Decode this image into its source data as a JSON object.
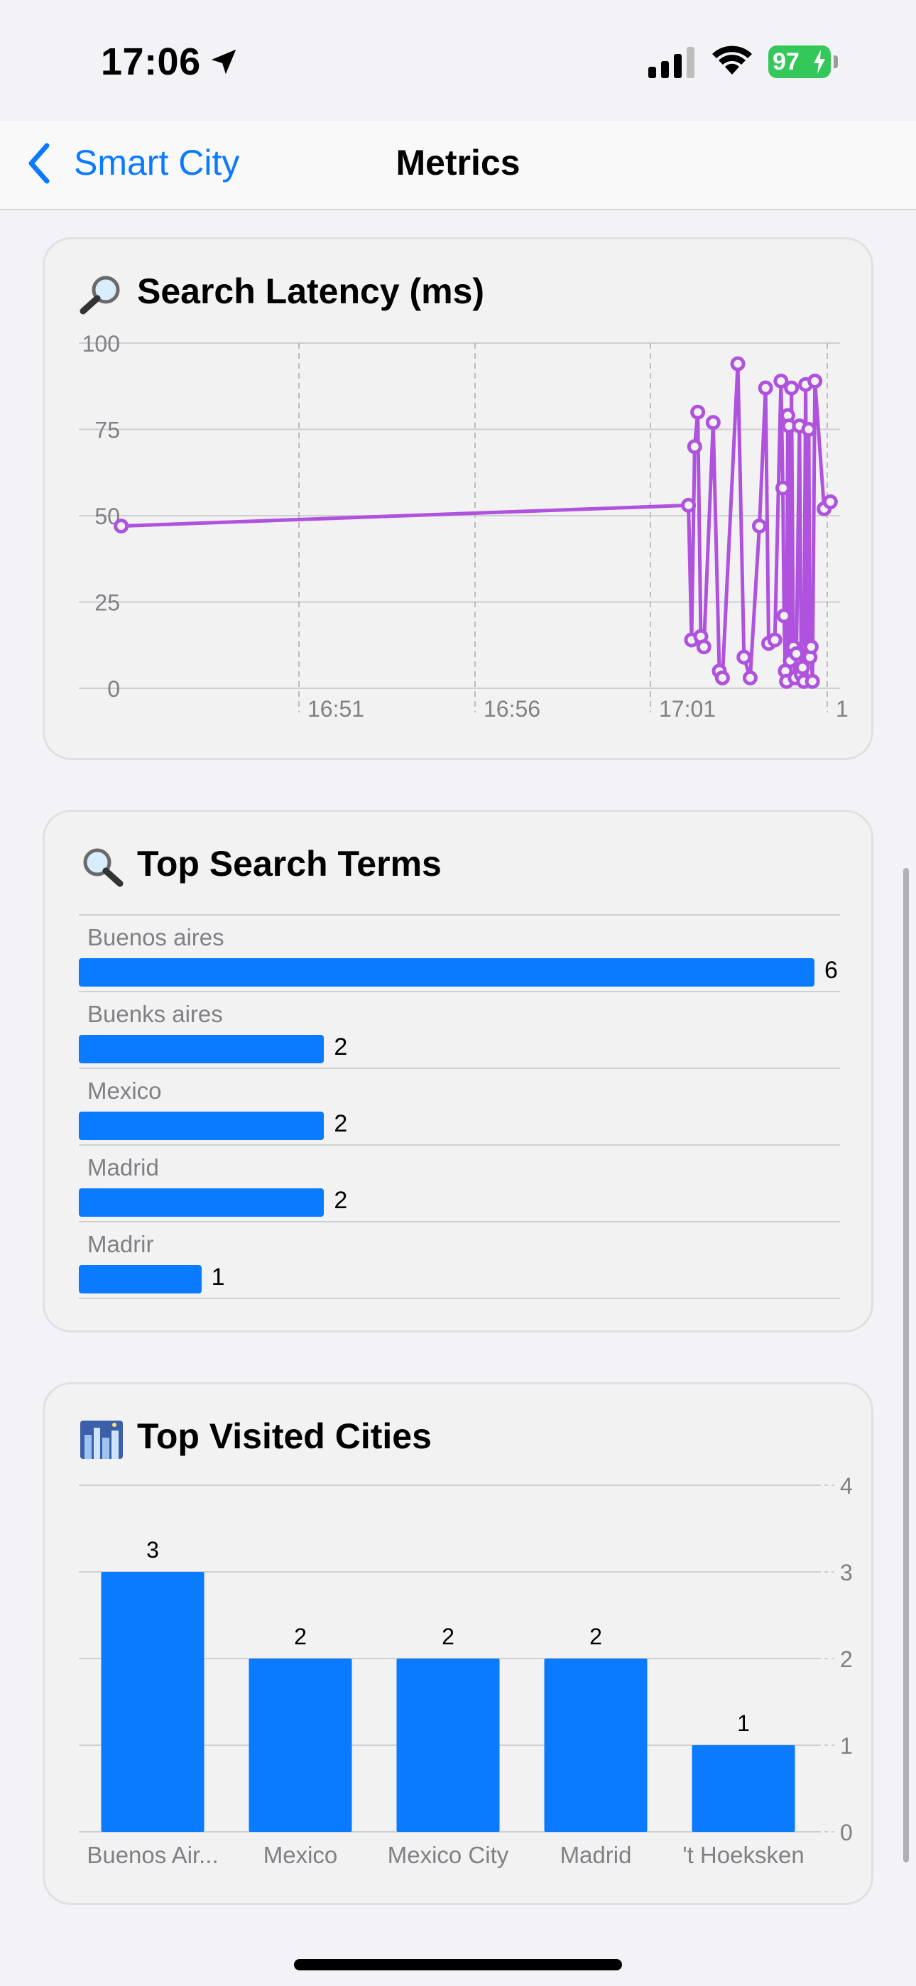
{
  "status": {
    "time": "17:06",
    "battery": "97"
  },
  "nav": {
    "back_label": "Smart City",
    "title": "Metrics"
  },
  "latency": {
    "title": "Search Latency (ms)",
    "icon": "magnifier-left-icon",
    "chart_data": {
      "type": "line",
      "ylim": [
        0,
        100
      ],
      "yticks": [
        0,
        25,
        50,
        75,
        100
      ],
      "xticks": [
        "16:51",
        "16:56",
        "17:01",
        "1"
      ],
      "color": "#af52de",
      "points": [
        {
          "t": "16:45:55",
          "y": 47
        },
        {
          "t": "17:01:15",
          "y": 53
        },
        {
          "t": "17:01:20",
          "y": 14
        },
        {
          "t": "17:01:25",
          "y": 70
        },
        {
          "t": "17:01:30",
          "y": 80
        },
        {
          "t": "17:01:35",
          "y": 15
        },
        {
          "t": "17:01:40",
          "y": 12
        },
        {
          "t": "17:01:55",
          "y": 77
        },
        {
          "t": "17:02:05",
          "y": 5
        },
        {
          "t": "17:02:10",
          "y": 3
        },
        {
          "t": "17:02:35",
          "y": 94
        },
        {
          "t": "17:02:45",
          "y": 9
        },
        {
          "t": "17:02:55",
          "y": 3
        },
        {
          "t": "17:03:10",
          "y": 47
        },
        {
          "t": "17:03:20",
          "y": 87
        },
        {
          "t": "17:03:25",
          "y": 13
        },
        {
          "t": "17:03:35",
          "y": 14
        },
        {
          "t": "17:03:45",
          "y": 89
        },
        {
          "t": "17:03:48",
          "y": 58
        },
        {
          "t": "17:03:50",
          "y": 21
        },
        {
          "t": "17:03:52",
          "y": 5
        },
        {
          "t": "17:03:54",
          "y": 2
        },
        {
          "t": "17:03:56",
          "y": 79
        },
        {
          "t": "17:03:58",
          "y": 76
        },
        {
          "t": "17:04:00",
          "y": 8
        },
        {
          "t": "17:04:02",
          "y": 87
        },
        {
          "t": "17:04:05",
          "y": 12
        },
        {
          "t": "17:04:08",
          "y": 3
        },
        {
          "t": "17:04:10",
          "y": 10
        },
        {
          "t": "17:04:15",
          "y": 76
        },
        {
          "t": "17:04:18",
          "y": 4
        },
        {
          "t": "17:04:20",
          "y": 6
        },
        {
          "t": "17:04:22",
          "y": 2
        },
        {
          "t": "17:04:25",
          "y": 88
        },
        {
          "t": "17:04:28",
          "y": 12
        },
        {
          "t": "17:04:30",
          "y": 75
        },
        {
          "t": "17:04:32",
          "y": 9
        },
        {
          "t": "17:04:34",
          "y": 12
        },
        {
          "t": "17:04:36",
          "y": 2
        },
        {
          "t": "17:04:40",
          "y": 89
        },
        {
          "t": "17:04:55",
          "y": 52
        },
        {
          "t": "17:05:05",
          "y": 54
        }
      ]
    }
  },
  "terms": {
    "title": "Top Search Terms",
    "icon": "magnifier-right-icon",
    "chart_data": {
      "type": "bar",
      "orientation": "horizontal",
      "categories": [
        "Buenos aires",
        "Buenks aires",
        "Mexico",
        "Madrid",
        "Madrir"
      ],
      "values": [
        6,
        2,
        2,
        2,
        1
      ],
      "color": "#0a7aff"
    }
  },
  "cities": {
    "title": "Top Visited Cities",
    "icon": "cityscape-icon",
    "chart_data": {
      "type": "bar",
      "categories": [
        "Buenos Air...",
        "Mexico",
        "Mexico City",
        "Madrid",
        "'t Hoeksken"
      ],
      "values": [
        3,
        2,
        2,
        2,
        1
      ],
      "ylim": [
        0,
        4
      ],
      "yticks": [
        0,
        1,
        2,
        3,
        4
      ],
      "color": "#0a7aff"
    }
  }
}
